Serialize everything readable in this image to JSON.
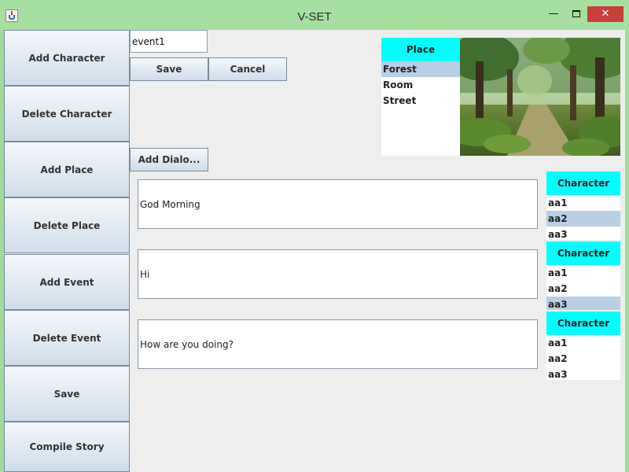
{
  "window": {
    "title": "V-SET",
    "minimize_label": "—",
    "close_label": "✕"
  },
  "sidebar": {
    "items": [
      {
        "label": "Add Character"
      },
      {
        "label": "Delete Character"
      },
      {
        "label": "Add Place"
      },
      {
        "label": "Delete Place"
      },
      {
        "label": "Add Event"
      },
      {
        "label": "Delete Event"
      },
      {
        "label": "Save"
      },
      {
        "label": "Compile Story"
      }
    ]
  },
  "event_panel": {
    "event_name": "event1",
    "save_label": "Save",
    "cancel_label": "Cancel",
    "add_dialog_label": "Add Dialo..."
  },
  "place_list": {
    "header": "Place",
    "items": [
      "Forest",
      "Room",
      "Street"
    ],
    "selected": "Forest"
  },
  "scene_image": {
    "icon": "forest-scene-image"
  },
  "dialogs": [
    {
      "text": "God Morning",
      "character_list": {
        "header": "Character",
        "items": [
          "aa1",
          "aa2",
          "aa3"
        ],
        "selected": "aa2"
      }
    },
    {
      "text": "Hi",
      "character_list": {
        "header": "Character",
        "items": [
          "aa1",
          "aa2",
          "aa3"
        ],
        "selected": "aa3"
      }
    },
    {
      "text": "How are you doing?",
      "character_list": {
        "header": "Character",
        "items": [
          "aa1",
          "aa2",
          "aa3"
        ],
        "selected": ""
      }
    }
  ],
  "colors": {
    "titlebar": "#a5e0a0",
    "list_header": "#00ffff",
    "selection": "#b8cfe5",
    "close_button": "#c7403a"
  }
}
